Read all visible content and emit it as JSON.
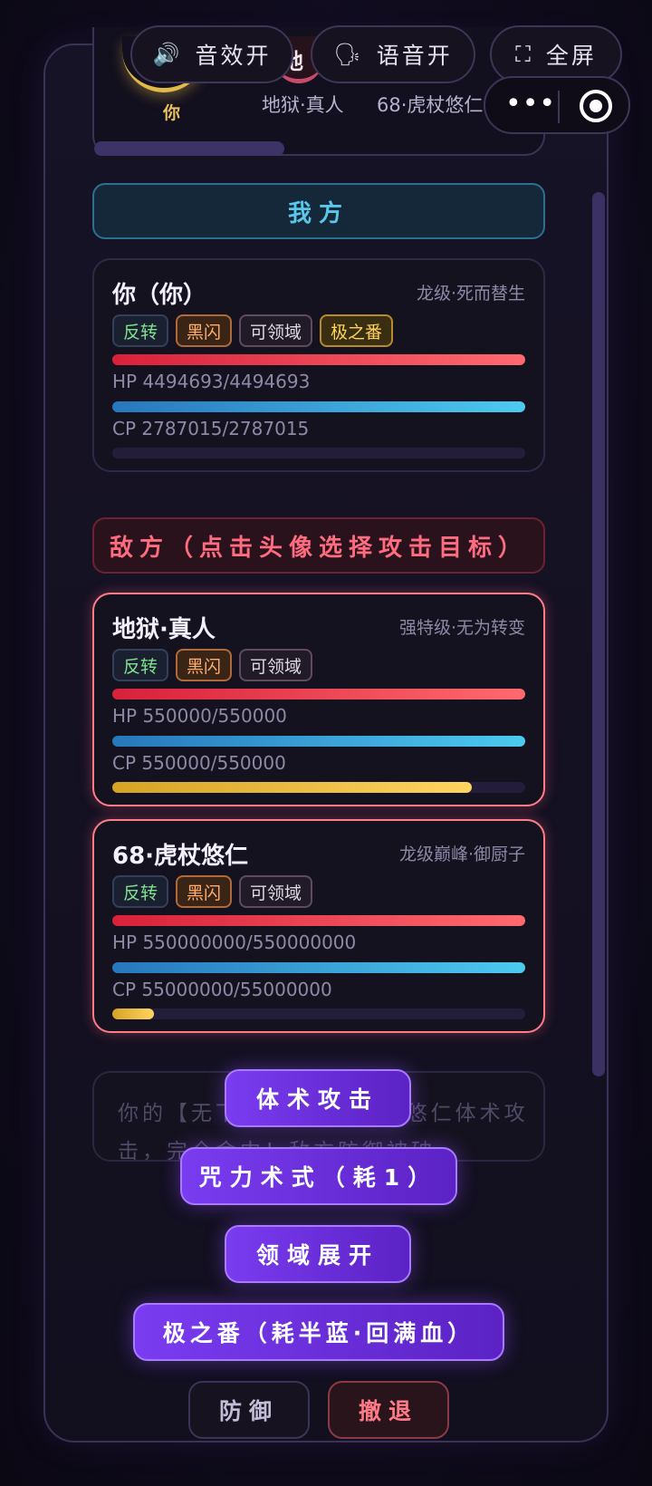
{
  "top_bar": {
    "sound_label": "音效开",
    "voice_label": "语音开",
    "fullscreen_label": "全屏",
    "more_label": "•••"
  },
  "summary": {
    "you_label": "你",
    "enemy_avatar_char": "地",
    "enemy_names": [
      "地狱·真人",
      "68·虎杖悠仁"
    ]
  },
  "ally_section": {
    "title": "我方",
    "fighter": {
      "name": "你（你）",
      "grade": "龙级·死而替生",
      "tags": [
        "反转",
        "黑闪",
        "可领域",
        "极之番"
      ],
      "hp_text": "HP 4494693/4494693",
      "cp_text": "CP 2787015/2787015",
      "hp": 1.0,
      "cp": 1.0,
      "charge": 0.0
    }
  },
  "enemy_section": {
    "title": "敌方（点击头像选择攻击目标）",
    "fighters": [
      {
        "name": "地狱·真人",
        "grade": "强特级·无为转变",
        "tags": [
          "反转",
          "黑闪",
          "可领域"
        ],
        "hp_text": "HP 550000/550000",
        "cp_text": "CP 550000/550000",
        "hp": 1.0,
        "cp": 1.0,
        "charge": 0.87
      },
      {
        "name": "68·虎杖悠仁",
        "grade": "龙级巅峰·御厨子",
        "tags": [
          "反转",
          "黑闪",
          "可领域"
        ],
        "hp_text": "HP 550000000/550000000",
        "cp_text": "CP 55000000/55000000",
        "hp": 1.0,
        "cp": 1.0,
        "charge": 0.1
      }
    ]
  },
  "log": {
    "text": "你的【无下限】对68·虎杖悠仁体术攻击，完全命中！敌方防御被破"
  },
  "actions": {
    "physical": "体术攻击",
    "cursed": "咒力术式（耗1）",
    "domain": "领域展开",
    "ultimate": "极之番（耗半蓝·回满血）",
    "defend": "防御",
    "retreat": "撤退"
  },
  "colors": {
    "accent_purple": "#7a3cf0",
    "ally_cyan": "#59c6ea",
    "enemy_red": "#ff6c7f",
    "hp_red": "#d8213a",
    "cp_blue": "#4ccaef",
    "charge_gold": "#ffd45f"
  }
}
